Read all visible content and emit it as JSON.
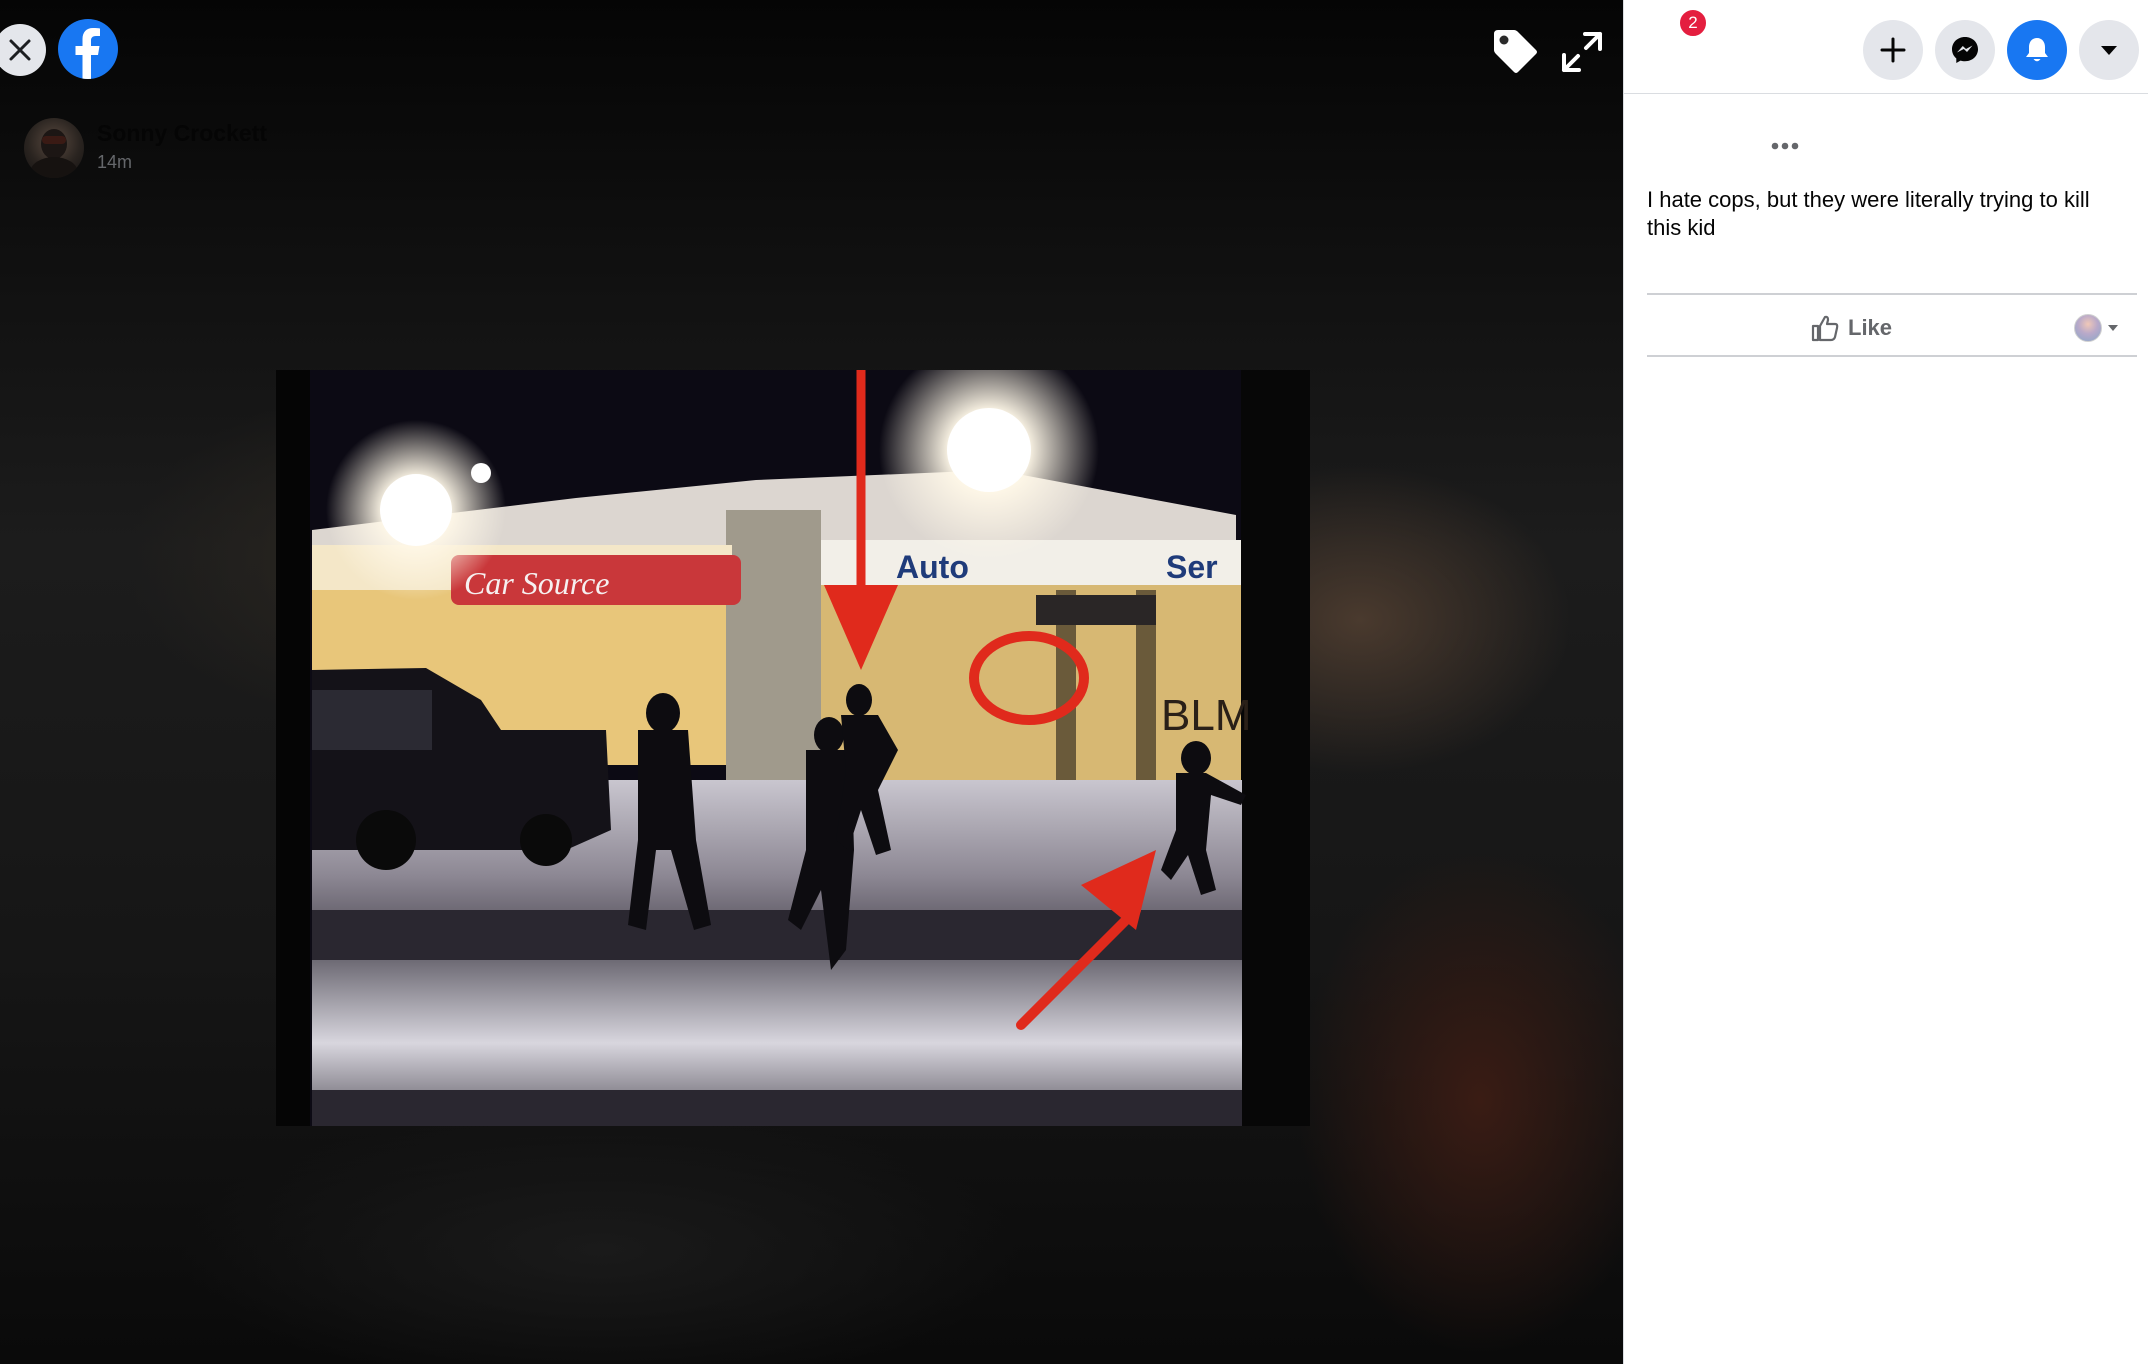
{
  "viewer": {
    "close_icon": "close-icon",
    "logo_icon": "facebook-logo-icon",
    "tag_icon": "tag-icon",
    "expand_icon": "fullscreen-icon",
    "photo": {
      "sign_left": "Car Source",
      "sign_center": "Auto",
      "sign_right": "Ser",
      "graffiti": "BLM"
    }
  },
  "topbar": {
    "create_icon": "plus-icon",
    "messenger_icon": "messenger-icon",
    "notifications_icon": "bell-icon",
    "notifications_count": "2",
    "account_icon": "caret-down-icon"
  },
  "post": {
    "author": "Sonny Crockett",
    "time": "14m",
    "more_icon": "more-horizontal-icon",
    "text": "I hate cops, but they were literally trying to kill this kid",
    "like_label": "Like",
    "like_icon": "thumbs-up-icon"
  },
  "colors": {
    "accent": "#1877f2",
    "badge": "#e41e3f",
    "annotation_red": "#e02a1c"
  }
}
